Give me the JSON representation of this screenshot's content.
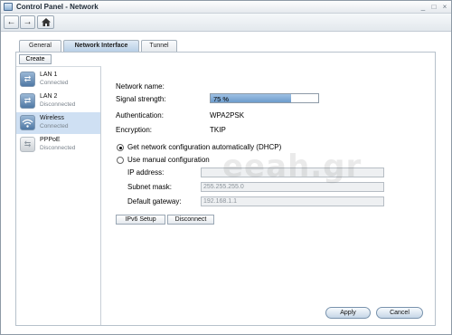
{
  "window": {
    "title": "Control Panel - Network"
  },
  "titlebar_buttons": [
    "_",
    "□",
    "×"
  ],
  "toolbar": {
    "back_icon": "left-arrow",
    "forward_icon": "right-arrow",
    "home_icon": "home"
  },
  "tabs": [
    {
      "label": "General",
      "active": false
    },
    {
      "label": "Network Interface",
      "active": true
    },
    {
      "label": "Tunnel",
      "active": false
    }
  ],
  "create_label": "Create",
  "sidebar": {
    "items": [
      {
        "name": "LAN 1",
        "status": "Connected",
        "icon": "lan-icon",
        "selected": false
      },
      {
        "name": "LAN 2",
        "status": "Disconnected",
        "icon": "lan-icon",
        "selected": false
      },
      {
        "name": "Wireless",
        "status": "Connected",
        "icon": "wireless-icon",
        "selected": true
      },
      {
        "name": "PPPoE",
        "status": "Disconnected",
        "icon": "pppoe-icon",
        "selected": false
      }
    ]
  },
  "form": {
    "network_name_label": "Network name:",
    "network_name_value": "",
    "signal_label": "Signal strength:",
    "signal_value": "75 %",
    "signal_fraction": 0.75,
    "auth_label": "Authentication:",
    "auth_value": "WPA2PSK",
    "enc_label": "Encryption:",
    "enc_value": "TKIP",
    "dhcp_label": "Get network configuration automatically (DHCP)",
    "manual_label": "Use manual configuration",
    "ip_label": "IP address:",
    "ip_value": "",
    "mask_label": "Subnet mask:",
    "mask_value": "255.255.255.0",
    "gateway_label": "Default gateway:",
    "gateway_value": "192.168.1.1"
  },
  "buttons": {
    "ipv6": "IPv6 Setup",
    "disconnect": "Disconnect",
    "apply": "Apply",
    "cancel": "Cancel"
  },
  "watermark": "eeah.gr"
}
